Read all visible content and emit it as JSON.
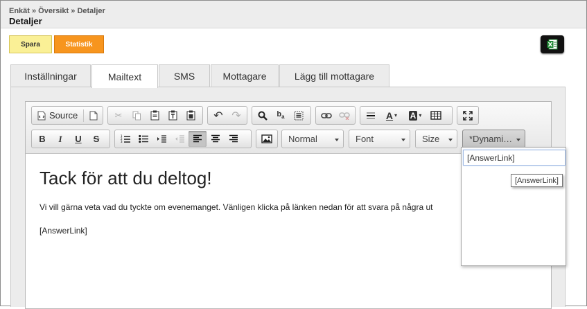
{
  "header": {
    "breadcrumb": "Enkät » Översikt » Detaljer",
    "title": "Detaljer"
  },
  "actions": {
    "save_label": "Spara",
    "stats_label": "Statistik",
    "excel_icon": "excel-icon"
  },
  "tabs": [
    {
      "label": "Inställningar",
      "active": false
    },
    {
      "label": "Mailtext",
      "active": true
    },
    {
      "label": "SMS",
      "active": false
    },
    {
      "label": "Mottagare",
      "active": false
    },
    {
      "label": "Lägg till mottagare",
      "active": false
    }
  ],
  "toolbar": {
    "source_label": "Source",
    "format_combo": "Normal",
    "font_combo": "Font",
    "size_combo": "Size",
    "dynamic_combo": "*Dynami…"
  },
  "content": {
    "heading": "Tack för att du deltog!",
    "paragraph": "Vi vill gärna veta vad du tyckte om evenemanget. Vänligen klicka på länken nedan för att svara på några ut",
    "link_placeholder": "[AnswerLink]"
  },
  "dropdown": {
    "items": [
      "[AnswerLink]"
    ],
    "tooltip": "[AnswerLink]"
  },
  "colors": {
    "save": "#faf096",
    "stats": "#f7951e",
    "tab_bg": "#ececec"
  }
}
